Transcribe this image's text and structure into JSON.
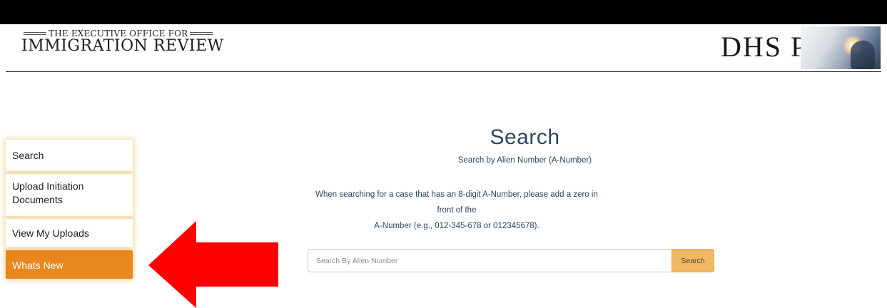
{
  "header": {
    "org_line1": "THE EXECUTIVE OFFICE FOR",
    "org_line2": "IMMIGRATION REVIEW",
    "portal_title": "DHS Portal"
  },
  "sidebar": {
    "items": [
      {
        "label": "Search"
      },
      {
        "label": "Upload Initiation Documents"
      },
      {
        "label": "View My Uploads"
      },
      {
        "label": "Whats New",
        "active": true
      }
    ]
  },
  "main": {
    "title": "Search",
    "subtitle": "Search by Alien Number (A-Number)",
    "note_line1": "When searching for a case that has an 8-digit A-Number, please add a zero in front of the",
    "note_line2": "A-Number (e.g., 012-345-678 or 012345678).",
    "search": {
      "placeholder": "Search By Alien Number",
      "value": "",
      "button_label": "Search"
    }
  },
  "annotation": {
    "arrow_color": "#ff0000",
    "arrow_direction": "left"
  },
  "colors": {
    "accent": "#e9861d",
    "heading": "#2e4660",
    "button": "#f0b865"
  }
}
